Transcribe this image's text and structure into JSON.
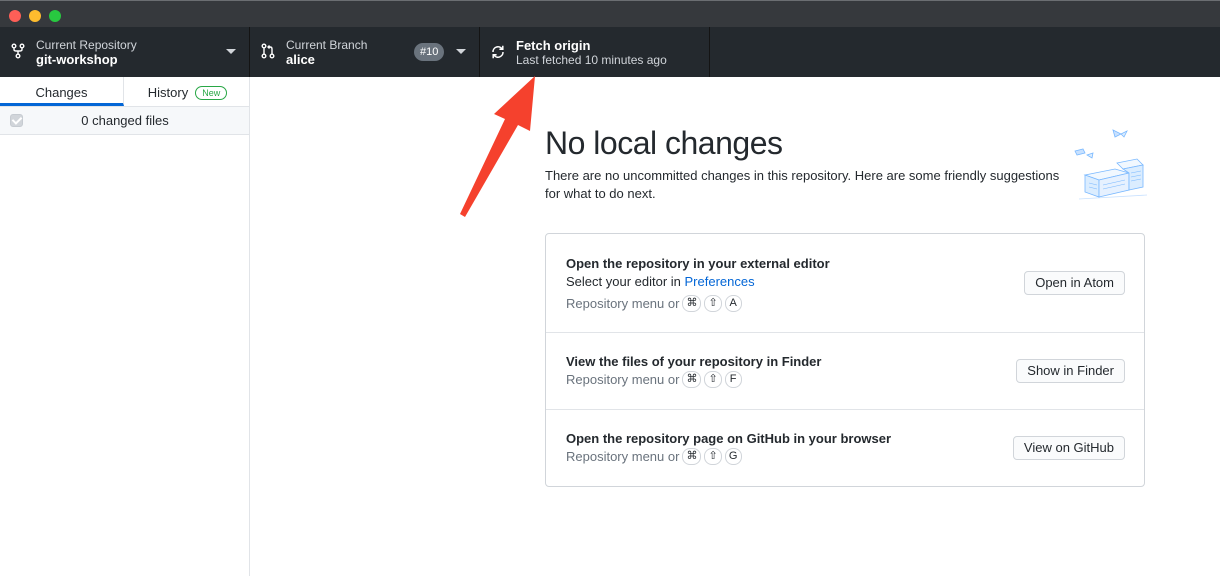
{
  "window": {
    "controls": [
      "close",
      "minimize",
      "zoom"
    ]
  },
  "toolbar": {
    "repo": {
      "label": "Current Repository",
      "value": "git-workshop",
      "icon": "repo-icon"
    },
    "branch": {
      "label": "Current Branch",
      "value": "alice",
      "pr_badge": "#10",
      "icon": "branch-icon"
    },
    "fetch": {
      "label": "Fetch origin",
      "status": "Last fetched 10 minutes ago",
      "icon": "sync-icon"
    }
  },
  "sidebar": {
    "tabs": {
      "changes": "Changes",
      "history": "History",
      "new_badge": "New"
    },
    "changed_files": "0 changed files"
  },
  "main": {
    "title": "No local changes",
    "description": "There are no uncommitted changes in this repository. Here are some friendly suggestions for what to do next.",
    "cards": [
      {
        "title": "Open the repository in your external editor",
        "sub_prefix": "Select your editor in ",
        "sub_link": "Preferences",
        "shortcut_prefix": "Repository menu or",
        "keys": [
          "⌘",
          "⇧",
          "A"
        ],
        "button": "Open in Atom"
      },
      {
        "title": "View the files of your repository in Finder",
        "shortcut_prefix": "Repository menu or",
        "keys": [
          "⌘",
          "⇧",
          "F"
        ],
        "button": "Show in Finder"
      },
      {
        "title": "Open the repository page on GitHub in your browser",
        "shortcut_prefix": "Repository menu or",
        "keys": [
          "⌘",
          "⇧",
          "G"
        ],
        "button": "View on GitHub"
      }
    ]
  },
  "colors": {
    "toolbar": "#24292e",
    "accent": "#0366d6",
    "annotation_arrow": "#f5412d",
    "new_badge": "#28a745"
  }
}
